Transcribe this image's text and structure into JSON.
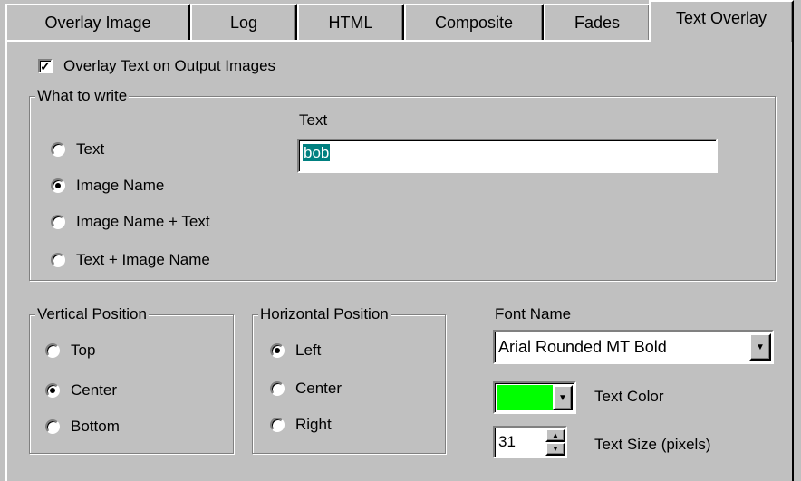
{
  "tabs": [
    {
      "label": "Overlay Image"
    },
    {
      "label": "Log"
    },
    {
      "label": "HTML"
    },
    {
      "label": "Composite"
    },
    {
      "label": "Fades"
    },
    {
      "label": "Text Overlay",
      "active": true
    }
  ],
  "overlay_checkbox": {
    "label": "Overlay Text on Output Images",
    "checked": true
  },
  "what_to_write": {
    "legend": "What to write",
    "options": [
      "Text",
      "Image Name",
      "Image Name + Text",
      "Text + Image Name"
    ],
    "selected": "Image Name",
    "text_label": "Text",
    "text_value": "bob"
  },
  "vertical_position": {
    "legend": "Vertical Position",
    "options": [
      "Top",
      "Center",
      "Bottom"
    ],
    "selected": "Center"
  },
  "horizontal_position": {
    "legend": "Horizontal Position",
    "options": [
      "Left",
      "Center",
      "Right"
    ],
    "selected": "Left"
  },
  "font": {
    "label": "Font Name",
    "value": "Arial Rounded MT Bold"
  },
  "text_color": {
    "label": "Text Color",
    "value": "#00ff00"
  },
  "text_size": {
    "label": "Text Size (pixels)",
    "value": "31"
  }
}
